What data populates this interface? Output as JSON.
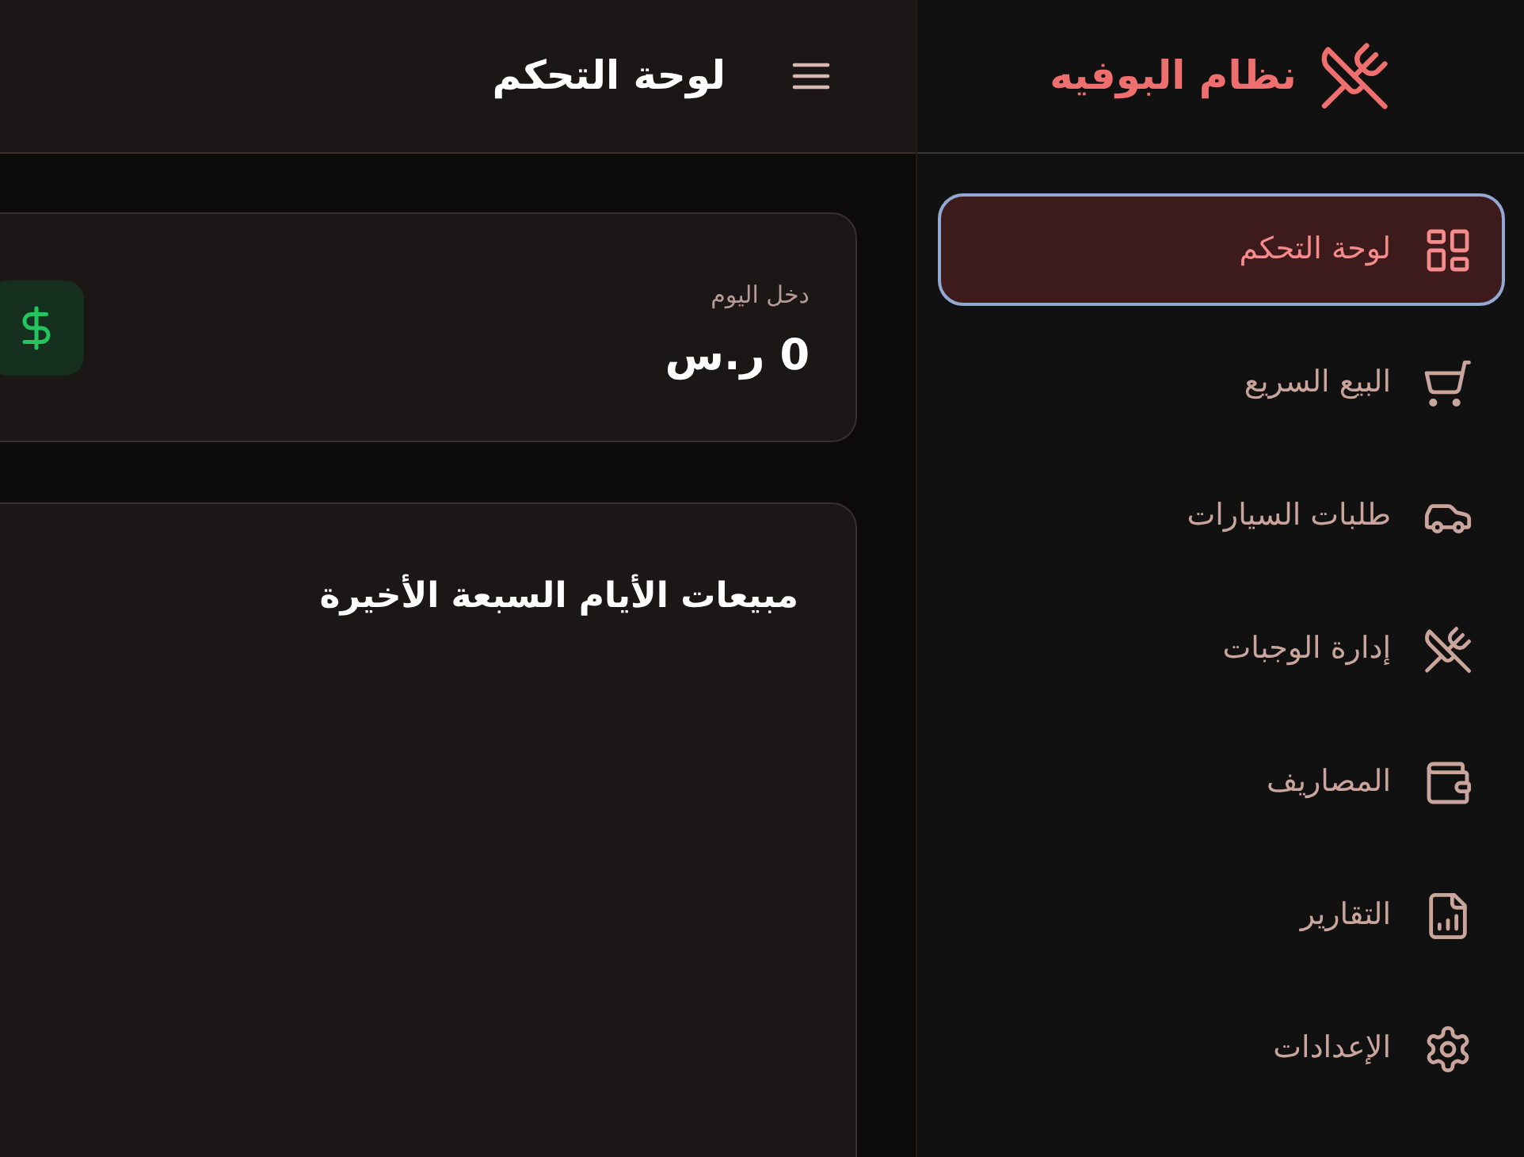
{
  "sidebar": {
    "logo": {
      "title": "نظام البوفيه"
    },
    "items": [
      {
        "label": "لوحة التحكم",
        "selected": true
      },
      {
        "label": "البيع السريع",
        "selected": false
      },
      {
        "label": "طلبات السيارات",
        "selected": false
      },
      {
        "label": "إدارة الوجبات",
        "selected": false
      },
      {
        "label": "المصاريف",
        "selected": false
      },
      {
        "label": "التقارير",
        "selected": false
      },
      {
        "label": "الإعدادات",
        "selected": false
      }
    ]
  },
  "header": {
    "title": "لوحة التحكم"
  },
  "stat_card": {
    "label": "دخل اليوم",
    "value": "0 ر.س"
  },
  "chart_card": {
    "title": "مبيعات الأيام السبعة الأخيرة"
  }
}
